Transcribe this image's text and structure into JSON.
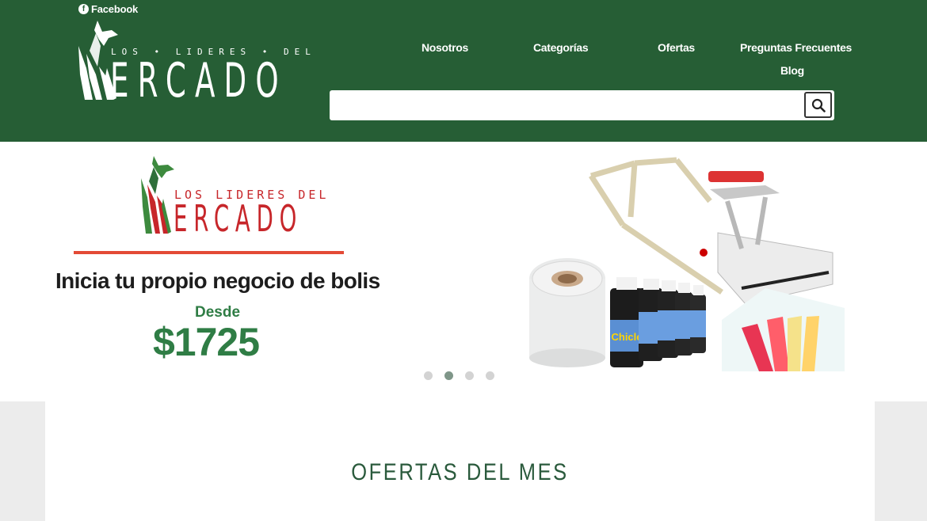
{
  "header": {
    "facebook_label": "Facebook",
    "logo": {
      "top_text": "LOS • LIDERES • DEL",
      "big_text": "ERCADO"
    },
    "nav": {
      "nosotros": "Nosotros",
      "categorias": "Categorías",
      "ofertas": "Ofertas",
      "faq": "Preguntas Frecuentes",
      "blog": "Blog"
    },
    "search": {
      "placeholder": "",
      "value": ""
    }
  },
  "hero": {
    "logo_top_text": "LOS LIDERES DEL",
    "logo_big_text": "ERCADO",
    "headline": "Inicia tu propio negocio de bolis",
    "desde": "Desde",
    "price": "$1725",
    "product_label": "Chicle",
    "slides_total": 4,
    "active_slide": 2
  },
  "section": {
    "title": "OFERTAS DEL MES"
  },
  "colors": {
    "header_bg": "#265e35",
    "accent_green": "#2f7d45",
    "logo_red": "#c7262a",
    "rule_red": "#e34a36"
  }
}
